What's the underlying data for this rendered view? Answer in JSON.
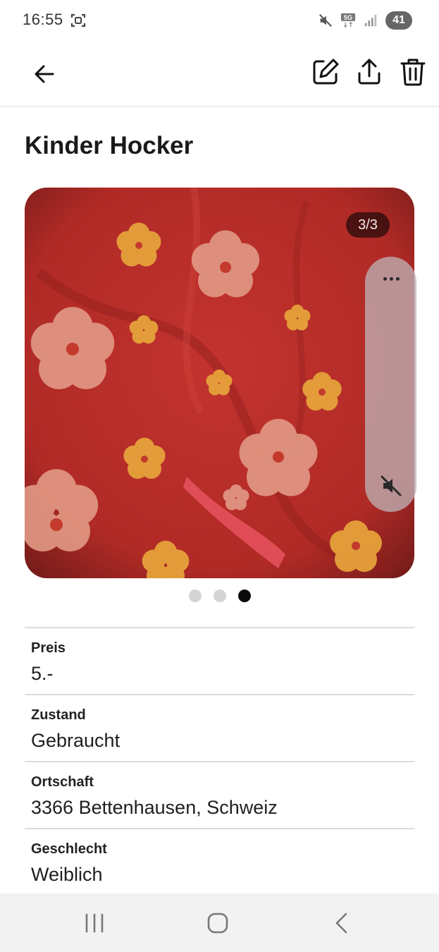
{
  "status_bar": {
    "time": "16:55",
    "battery": "41",
    "icons": [
      "screenshot-icon",
      "mute-icon",
      "5g-icon",
      "signal-icon",
      "battery-icon"
    ]
  },
  "app_bar": {
    "icons": [
      "back-arrow-icon",
      "edit-icon",
      "share-icon",
      "trash-icon"
    ]
  },
  "title": "Kinder Hocker",
  "gallery": {
    "counter": "3/3",
    "current_index": 3,
    "total": 3,
    "panel_icons": [
      "more-icon",
      "sound-off-icon"
    ]
  },
  "details": [
    {
      "label": "Preis",
      "value": "5.-"
    },
    {
      "label": "Zustand",
      "value": "Gebraucht"
    },
    {
      "label": "Ortschaft",
      "value": "3366 Bettenhausen, Schweiz"
    },
    {
      "label": "Geschlecht",
      "value": "Weiblich"
    }
  ],
  "nav_bar": {
    "icons": [
      "recents-icon",
      "home-icon",
      "back-icon"
    ]
  },
  "colors": {
    "fabric_red": "#b8302c",
    "flower_yellow": "#e8a43a",
    "flower_light": "#e89a86",
    "accent_dark": "#0b0b0b"
  }
}
